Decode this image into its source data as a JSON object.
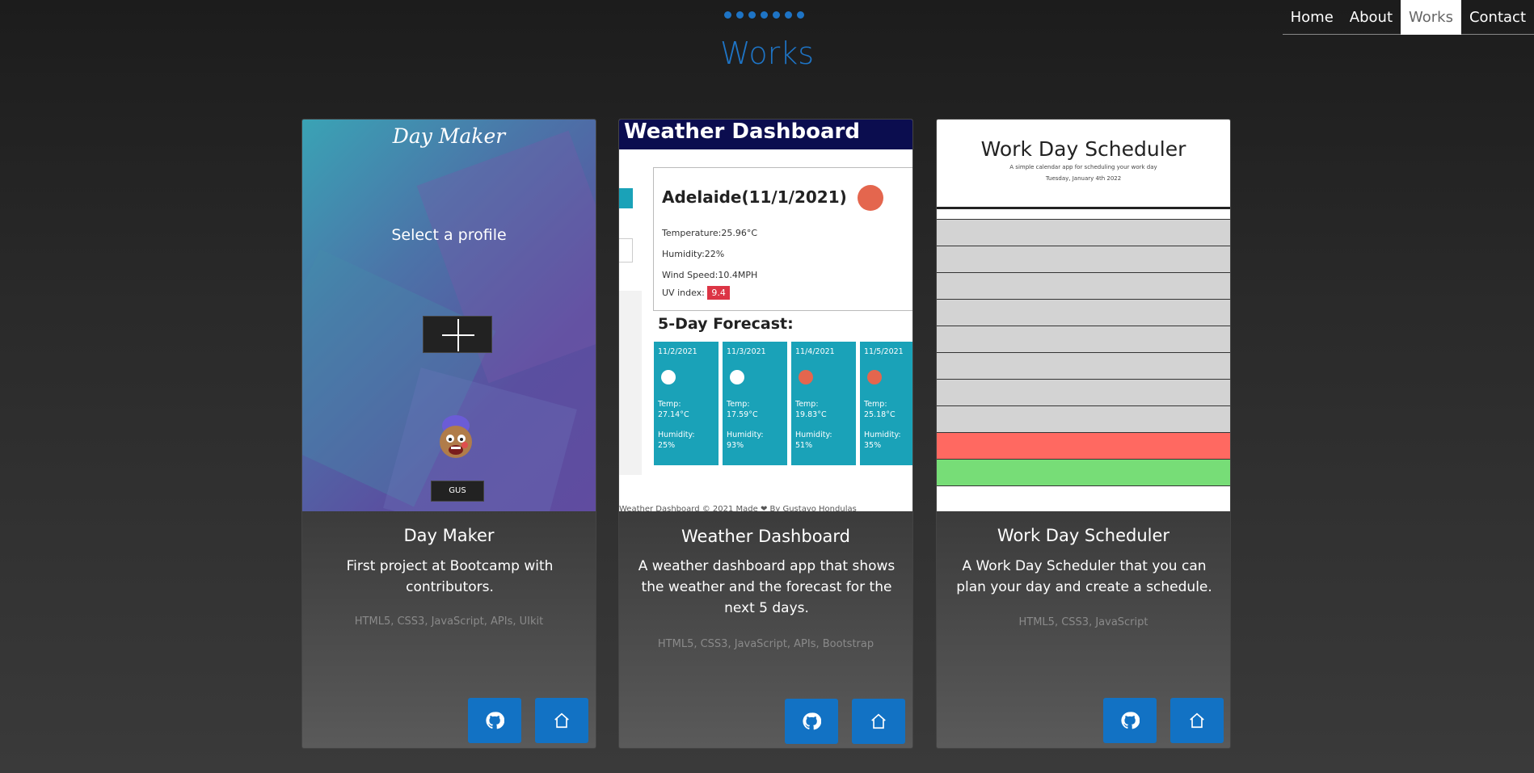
{
  "nav": {
    "items": [
      {
        "label": "Home",
        "active": false
      },
      {
        "label": "About",
        "active": false
      },
      {
        "label": "Works",
        "active": true
      },
      {
        "label": "Contact",
        "active": false
      }
    ]
  },
  "header": {
    "title": "Works",
    "accent_color": "#1e74c5"
  },
  "cards": [
    {
      "title": "Day Maker",
      "description": "First project at Bootcamp with contributors.",
      "tags": "HTML5, CSS3, JavaScript, APIs, UIkit",
      "thumb": {
        "logo": "Day Maker",
        "heading": "Select a profile",
        "profile_name": "GUS"
      },
      "buttons": {
        "github_icon": "github-icon",
        "home_icon": "home-icon"
      }
    },
    {
      "title": "Weather Dashboard",
      "description": "A weather dashboard app that shows the weather and the forecast for the next 5 days.",
      "tags": "HTML5, CSS3, JavaScript, APIs, Bootstrap",
      "thumb": {
        "header": "Weather Dashboard",
        "city": "Adelaide(11/1/2021)",
        "temperature": "Temperature:25.96°C",
        "humidity": "Humidity:22%",
        "wind": "Wind Speed:10.4MPH",
        "uv_label": "UV index:",
        "uv_value": "9.4",
        "forecast_title": "5-Day Forecast:",
        "forecast": [
          {
            "date": "11/2/2021",
            "temp_label": "Temp:",
            "temp": "27.14°C",
            "hum_label": "Humidity:",
            "humidity": "25%"
          },
          {
            "date": "11/3/2021",
            "temp_label": "Temp:",
            "temp": "17.59°C",
            "hum_label": "Humidity:",
            "humidity": "93%"
          },
          {
            "date": "11/4/2021",
            "temp_label": "Temp:",
            "temp": "19.83°C",
            "hum_label": "Humidity:",
            "humidity": "51%"
          },
          {
            "date": "11/5/2021",
            "temp_label": "Temp:",
            "temp": "25.18°C",
            "hum_label": "Humidity:",
            "humidity": "35%"
          }
        ],
        "footer": "Weather Dashboard © 2021 Made ❤ By Gustavo Hondulas"
      },
      "buttons": {
        "github_icon": "github-icon",
        "home_icon": "home-icon"
      }
    },
    {
      "title": "Work Day Scheduler",
      "description": "A Work Day Scheduler that you can plan your day and create a schedule.",
      "tags": "HTML5, CSS3, JavaScript",
      "thumb": {
        "title": "Work Day Scheduler",
        "subtitle": "A simple calendar app for scheduling your work day",
        "date": "Tuesday, January 4th 2022",
        "row_colors": [
          "#d3d3d3",
          "#d3d3d3",
          "#d3d3d3",
          "#d3d3d3",
          "#d3d3d3",
          "#d3d3d3",
          "#d3d3d3",
          "#d3d3d3",
          "#ff6961",
          "#77dd77",
          "#ffffff"
        ]
      },
      "buttons": {
        "github_icon": "github-icon",
        "home_icon": "home-icon"
      }
    }
  ]
}
